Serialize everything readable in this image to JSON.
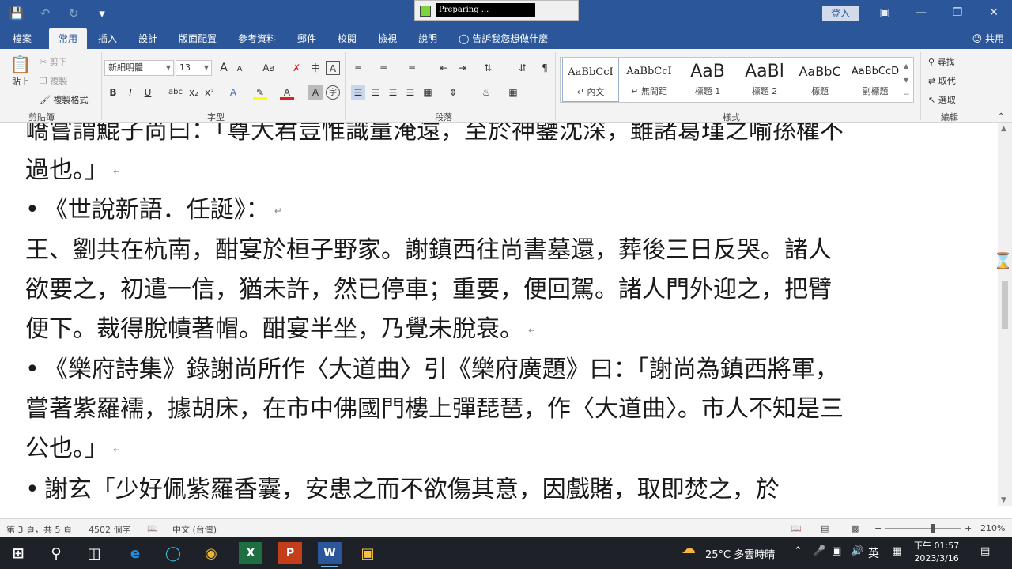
{
  "titlebar": {
    "save_icon": "save-icon",
    "preparing_text": "Preparing ...",
    "signin": "登入",
    "more": "▾"
  },
  "tabs": [
    "檔案",
    "常用",
    "插入",
    "設計",
    "版面配置",
    "參考資料",
    "郵件",
    "校閱",
    "檢視",
    "說明"
  ],
  "active_tab": "常用",
  "tell_me": "告訴我您想做什麼",
  "share": "共用",
  "clipboard": {
    "paste": "貼上",
    "cut": "剪下",
    "copy": "複製",
    "format_painter": "複製格式",
    "label": "剪貼簿"
  },
  "font": {
    "name": "新細明體",
    "size": "13",
    "label": "字型",
    "bold": "B",
    "italic": "I",
    "underline": "U",
    "strike": "abc",
    "sub": "x₂",
    "sup": "x²",
    "grow": "A",
    "shrink": "A",
    "case": "Aa",
    "phonetic": "中",
    "border": "A",
    "font_color": "A",
    "shade": "A",
    "enclose": "字"
  },
  "paragraph": {
    "label": "段落"
  },
  "styles": {
    "label": "樣式",
    "items": [
      {
        "preview": "AaBbCcI",
        "name": "內文",
        "prefix": "↵"
      },
      {
        "preview": "AaBbCcI",
        "name": "無間距",
        "prefix": "↵"
      },
      {
        "preview": "AaB",
        "name": "標題 1",
        "prefix": ""
      },
      {
        "preview": "AaBl",
        "name": "標題 2",
        "prefix": ""
      },
      {
        "preview": "AaBbC",
        "name": "標題",
        "prefix": ""
      },
      {
        "preview": "AaBbCcD",
        "name": "副標題",
        "prefix": ""
      }
    ]
  },
  "editing": {
    "find": "尋找",
    "replace": "取代",
    "select": "選取",
    "label": "編輯"
  },
  "document": {
    "lines": [
      "嶠嘗謂鯤子尚曰：「尊大君豈惟識量淹遠，至於神鑒沈深，雖諸葛瑾之喻孫權不",
      "過也。」",
      "《世說新語．任誕》：",
      "王、劉共在杭南，酣宴於桓子野家。謝鎮西往尚書墓還，葬後三日反哭。諸人",
      "欲要之，初遣一信，猶未許，然已停車；重要，便回駕。諸人門外迎之，把臂",
      "便下。裁得脫幘著帽。酣宴半坐，乃覺未脫衰。",
      "《樂府詩集》錄謝尚所作〈大道曲〉引《樂府廣題》曰：「謝尚為鎮西將軍，",
      "嘗著紫羅襦，據胡床，在市中佛國門樓上彈琵琶，作〈大道曲〉。市人不知是三",
      "公也。」",
      "謝玄「少好佩紫羅香囊，安患之而不欲傷其意，因戲賭，取即焚之，於"
    ],
    "bullet": "•",
    "para_mark": "↵"
  },
  "status": {
    "page": "第 3 頁，共 5 頁",
    "words": "4502 個字",
    "language": "中文 (台灣)",
    "zoom": "210%",
    "zoom_minus": "−",
    "zoom_plus": "+"
  },
  "taskbar": {
    "weather": "25°C 多雲時晴",
    "ime": "英",
    "time": "下午 01:57",
    "date": "2023/3/16"
  }
}
